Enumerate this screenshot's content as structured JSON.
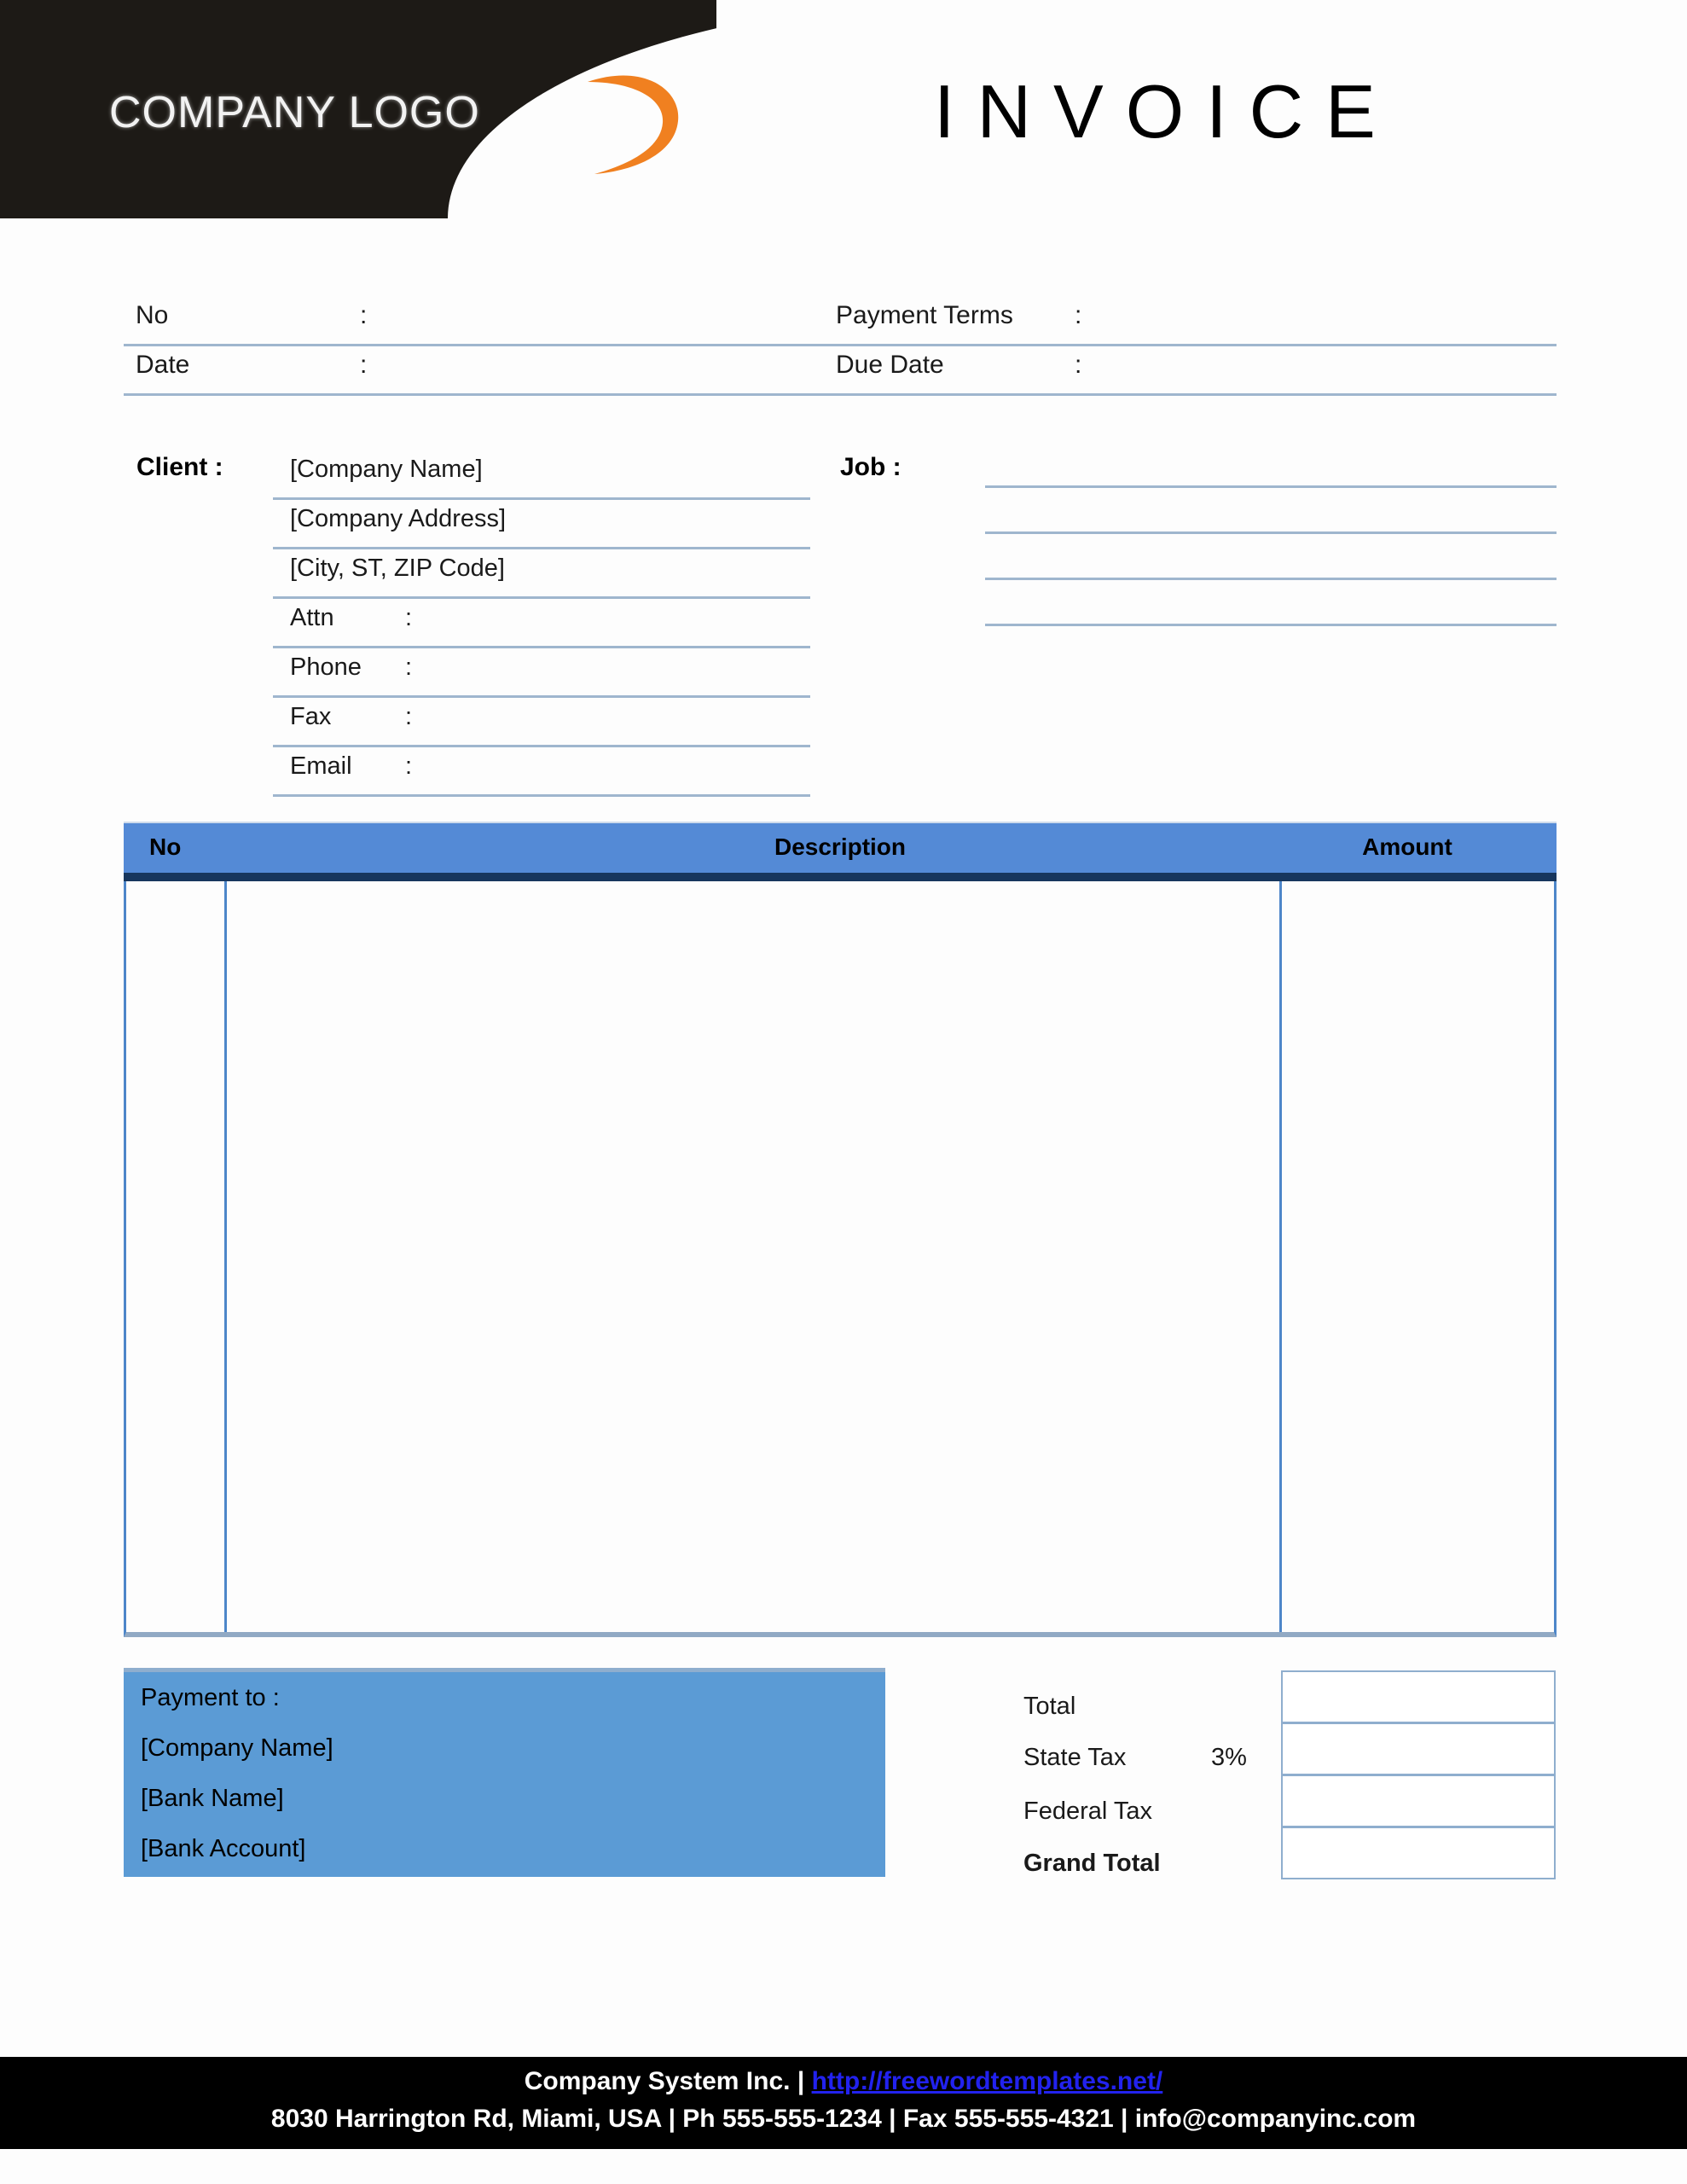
{
  "header": {
    "logo_text": "COMPANY LOGO",
    "logo_swoosh_icon": "swoosh-icon",
    "logo_swoosh_color": "#F08020",
    "title": "INVOICE"
  },
  "meta": {
    "rows": [
      {
        "left_label": "No",
        "left_colon": ":",
        "left_value": "",
        "right_label": "Payment  Terms",
        "right_colon": ":",
        "right_value": ""
      },
      {
        "left_label": "Date",
        "left_colon": ":",
        "left_value": "",
        "right_label": "Due Date",
        "right_colon": ":",
        "right_value": ""
      }
    ]
  },
  "client": {
    "label": "Client  :",
    "lines": [
      {
        "text": "[Company Name]",
        "colon": "",
        "value": ""
      },
      {
        "text": "[Company Address]",
        "colon": "",
        "value": ""
      },
      {
        "text": "[City, ST, ZIP Code]",
        "colon": "",
        "value": ""
      },
      {
        "text": "Attn",
        "colon": ":",
        "value": ""
      },
      {
        "text": "Phone",
        "colon": ":",
        "value": ""
      },
      {
        "text": "Fax",
        "colon": ":",
        "value": ""
      },
      {
        "text": "Email",
        "colon": ":",
        "value": ""
      }
    ]
  },
  "job": {
    "label": "Job  :",
    "lines": [
      "",
      "",
      "",
      ""
    ]
  },
  "items": {
    "columns": [
      "No",
      "Description",
      "Amount"
    ],
    "rows": [],
    "header_bg": "#548AD6",
    "header_rule": "#17365D",
    "grid_color": "#4D86C9"
  },
  "payment": {
    "bg": "#5B9BD5",
    "lines": [
      "Payment to :",
      "[Company Name]",
      "[Bank Name]",
      "[Bank Account]"
    ]
  },
  "totals": {
    "rows": [
      {
        "label": "Total",
        "rate": "",
        "value": "",
        "bold": false
      },
      {
        "label": "State Tax",
        "rate": "3%",
        "value": "",
        "bold": false
      },
      {
        "label": "Federal Tax",
        "rate": "",
        "value": "",
        "bold": false
      },
      {
        "label": "Grand Total",
        "rate": "",
        "value": "",
        "bold": true
      }
    ]
  },
  "footer": {
    "company": "Company System Inc. ",
    "separator_1": "| ",
    "url": "http://freewordtemplates.net/",
    "address_line": "8030 Harrington Rd, Miami, USA | Ph 555-555-1234 | Fax 555-555-4321 | info@companyinc.com",
    "bg": "#000000",
    "url_color": "#2222EE"
  }
}
